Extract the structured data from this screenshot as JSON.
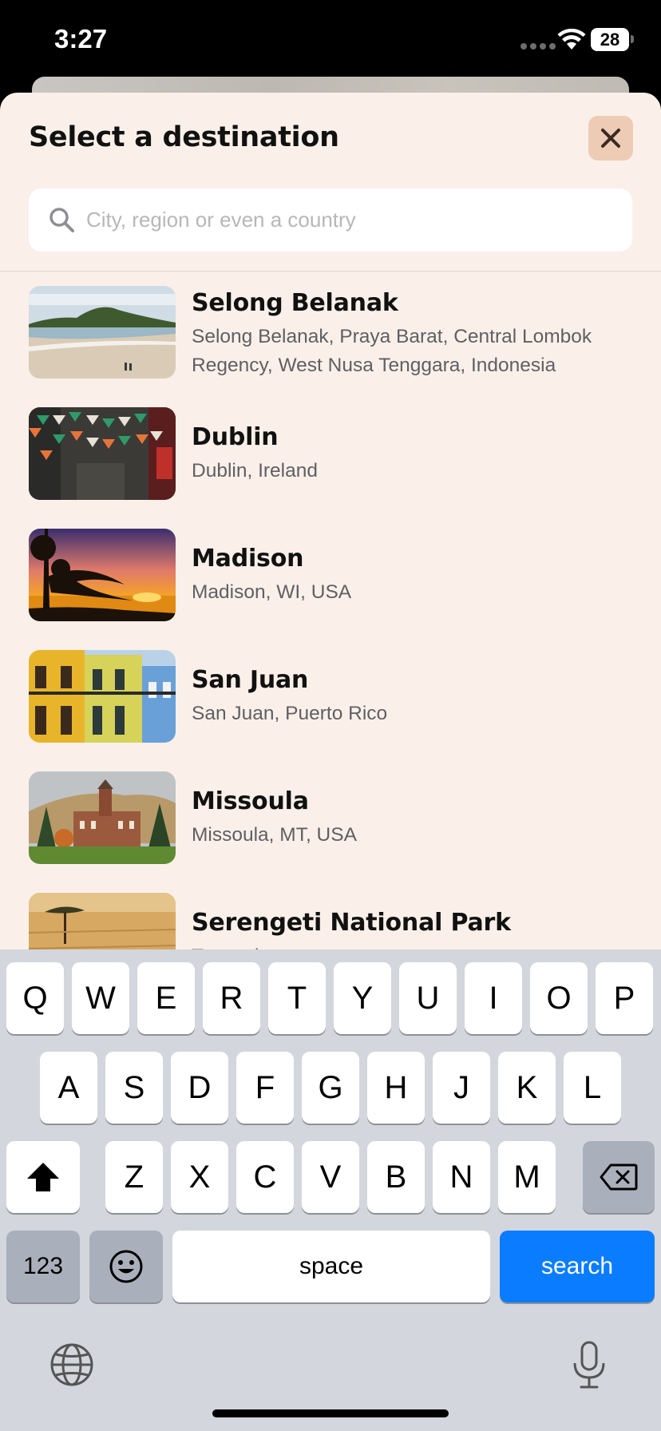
{
  "status_bar": {
    "time": "3:27",
    "battery": "28"
  },
  "sheet": {
    "title": "Select a destination",
    "search_placeholder": "City, region or even a country"
  },
  "destinations": [
    {
      "name": "Selong Belanak",
      "subtitle": "Selong Belanak, Praya Barat, Central Lombok Regency, West Nusa Tenggara, Indonesia",
      "thumb": "beach"
    },
    {
      "name": "Dublin",
      "subtitle": "Dublin, Ireland",
      "thumb": "street-flags"
    },
    {
      "name": "Madison",
      "subtitle": "Madison, WI, USA",
      "thumb": "sunset-lake"
    },
    {
      "name": "San Juan",
      "subtitle": "San Juan, Puerto Rico",
      "thumb": "colorful-buildings"
    },
    {
      "name": "Missoula",
      "subtitle": "Missoula, MT, USA",
      "thumb": "campus-building"
    },
    {
      "name": "Serengeti National Park",
      "subtitle": "Tanzania",
      "thumb": "savanna"
    }
  ],
  "keyboard": {
    "row1": [
      "Q",
      "W",
      "E",
      "R",
      "T",
      "Y",
      "U",
      "I",
      "O",
      "P"
    ],
    "row2": [
      "A",
      "S",
      "D",
      "F",
      "G",
      "H",
      "J",
      "K",
      "L"
    ],
    "row3": [
      "Z",
      "X",
      "C",
      "V",
      "B",
      "N",
      "M"
    ],
    "numbers_label": "123",
    "space_label": "space",
    "action_label": "search",
    "icons": {
      "shift": "shift-icon",
      "delete": "backspace-icon",
      "emoji": "emoji-icon",
      "globe": "globe-icon",
      "mic": "microphone-icon"
    }
  },
  "colors": {
    "sheet_bg": "#faf0e9",
    "close_bg": "#edcbb5",
    "action_key": "#0a7cff",
    "keyboard_bg": "#d3d6dc"
  }
}
